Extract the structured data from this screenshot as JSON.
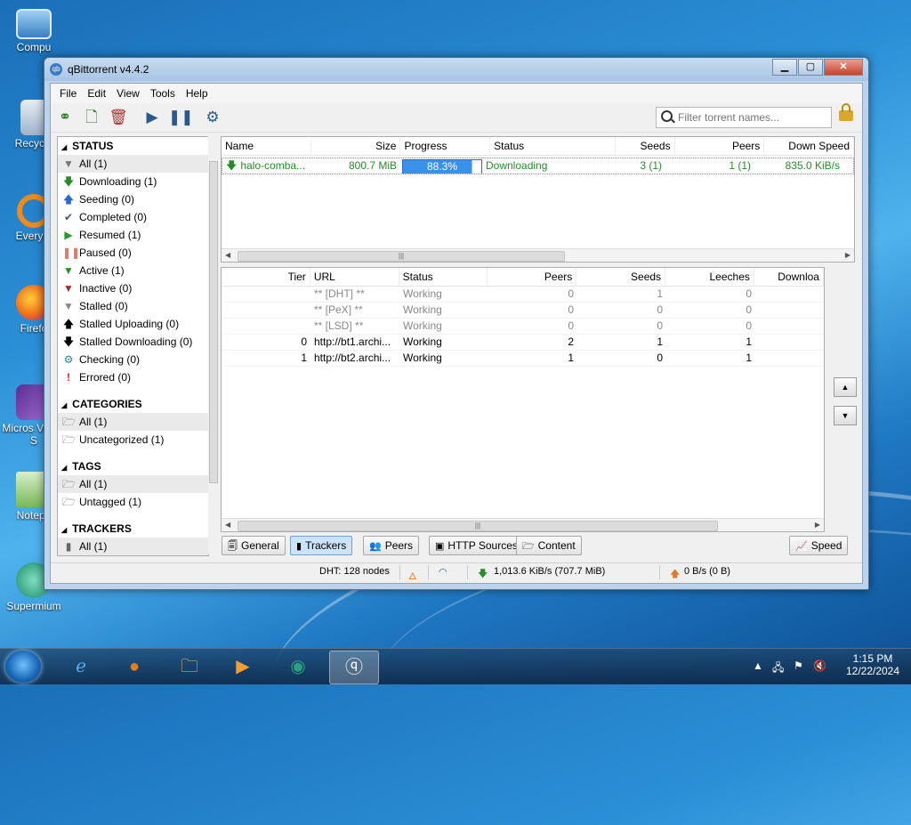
{
  "desktop": {
    "icons": [
      {
        "label": "Compu",
        "icon": "computer-icon"
      },
      {
        "label": "Recycle",
        "icon": "recycle-bin-icon"
      },
      {
        "label": "Everyth",
        "icon": "everything-icon"
      },
      {
        "label": "Firefo",
        "icon": "firefox-icon"
      },
      {
        "label": "Micros Visual S",
        "icon": "visual-studio-icon"
      },
      {
        "label": "Notepa",
        "icon": "notepad-icon"
      },
      {
        "label": "Supermium",
        "icon": "supermium-icon"
      }
    ]
  },
  "window": {
    "title": "qBittorrent v4.4.2",
    "icon_text": "qb"
  },
  "menu": [
    "File",
    "Edit",
    "View",
    "Tools",
    "Help"
  ],
  "search": {
    "placeholder": "Filter torrent names..."
  },
  "sidebar": {
    "status_header": "STATUS",
    "status_items": [
      {
        "label": "All (1)",
        "icon": "filter-icon"
      },
      {
        "label": "Downloading (1)",
        "icon": "download-arrow-icon"
      },
      {
        "label": "Seeding (0)",
        "icon": "upload-arrow-icon"
      },
      {
        "label": "Completed (0)",
        "icon": "checkmark-icon"
      },
      {
        "label": "Resumed (1)",
        "icon": "play-icon"
      },
      {
        "label": "Paused (0)",
        "icon": "pause-icon"
      },
      {
        "label": "Active (1)",
        "icon": "filter-green-icon"
      },
      {
        "label": "Inactive (0)",
        "icon": "filter-red-icon"
      },
      {
        "label": "Stalled (0)",
        "icon": "filter-gray-icon"
      },
      {
        "label": "Stalled Uploading (0)",
        "icon": "up-arrow-black-icon"
      },
      {
        "label": "Stalled Downloading (0)",
        "icon": "down-arrow-black-icon"
      },
      {
        "label": "Checking (0)",
        "icon": "gear-icon"
      },
      {
        "label": "Errored (0)",
        "icon": "error-icon"
      }
    ],
    "categories_header": "CATEGORIES",
    "category_items": [
      "All (1)",
      "Uncategorized (1)"
    ],
    "tags_header": "TAGS",
    "tag_items": [
      "All (1)",
      "Untagged (1)"
    ],
    "trackers_header": "TRACKERS",
    "tracker_items": [
      "All (1)"
    ]
  },
  "torrents": {
    "columns": [
      "Name",
      "Size",
      "Progress",
      "Status",
      "Seeds",
      "Peers",
      "Down Speed"
    ],
    "rows": [
      {
        "name": "halo-comba...",
        "size": "800.7 MiB",
        "progress": "88.3%",
        "progress_value": 0.883,
        "status": "Downloading",
        "seeds": "3 (1)",
        "peers": "1 (1)",
        "down_speed": "835.0 KiB/s"
      }
    ]
  },
  "trackers": {
    "columns": [
      "Tier",
      "URL",
      "Status",
      "Peers",
      "Seeds",
      "Leeches",
      "Downloa"
    ],
    "rows": [
      {
        "tier": "",
        "url": "** [DHT] **",
        "status": "Working",
        "peers": "0",
        "seeds": "1",
        "leeches": "0",
        "muted": true
      },
      {
        "tier": "",
        "url": "** [PeX] **",
        "status": "Working",
        "peers": "0",
        "seeds": "0",
        "leeches": "0",
        "muted": true
      },
      {
        "tier": "",
        "url": "** [LSD] **",
        "status": "Working",
        "peers": "0",
        "seeds": "0",
        "leeches": "0",
        "muted": true
      },
      {
        "tier": "0",
        "url": "http://bt1.archi...",
        "status": "Working",
        "peers": "2",
        "seeds": "1",
        "leeches": "1",
        "muted": false
      },
      {
        "tier": "1",
        "url": "http://bt2.archi...",
        "status": "Working",
        "peers": "1",
        "seeds": "0",
        "leeches": "1",
        "muted": false
      }
    ]
  },
  "tabs": [
    {
      "label": "General",
      "icon": "general-icon"
    },
    {
      "label": "Trackers",
      "icon": "trackers-icon"
    },
    {
      "label": "Peers",
      "icon": "peers-icon"
    },
    {
      "label": "HTTP Sources",
      "icon": "http-sources-icon"
    },
    {
      "label": "Content",
      "icon": "content-folder-icon"
    }
  ],
  "speed_button": "Speed",
  "statusbar": {
    "dht": "DHT: 128 nodes",
    "download": "1,013.6 KiB/s (707.7 MiB)",
    "upload": "0 B/s (0 B)"
  },
  "taskbar": {
    "time": "1:15 PM",
    "date": "12/22/2024"
  },
  "colors": {
    "accent": "#3a92e8",
    "downloading": "#2a8a2a"
  }
}
